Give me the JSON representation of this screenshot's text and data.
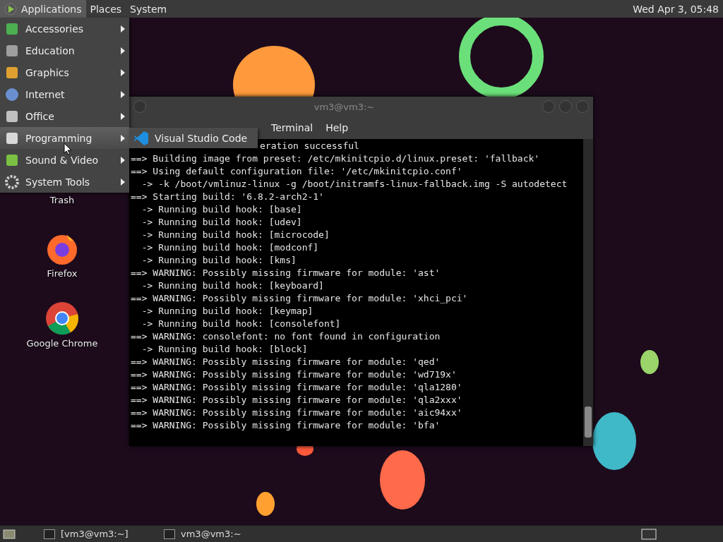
{
  "top_panel": {
    "menus": [
      {
        "label": "Applications",
        "selected": true
      },
      {
        "label": "Places",
        "selected": false
      },
      {
        "label": "System",
        "selected": false
      }
    ],
    "clock": "Wed Apr 3, 05:48"
  },
  "applications_menu": {
    "items": [
      {
        "label": "Accessories",
        "selected": false
      },
      {
        "label": "Education",
        "selected": false
      },
      {
        "label": "Graphics",
        "selected": false
      },
      {
        "label": "Internet",
        "selected": false
      },
      {
        "label": "Office",
        "selected": false
      },
      {
        "label": "Programming",
        "selected": true
      },
      {
        "label": "Sound & Video",
        "selected": false
      },
      {
        "label": "System Tools",
        "selected": false
      }
    ],
    "submenu": [
      {
        "label": "Visual Studio Code"
      }
    ]
  },
  "desktop_icons": [
    {
      "label": "Trash",
      "kind": "trash"
    },
    {
      "label": "Firefox",
      "kind": "firefox"
    },
    {
      "label": "Google Chrome",
      "kind": "chrome"
    }
  ],
  "terminal": {
    "title": "vm3@vm3:~",
    "menu": [
      "Terminal",
      "Help"
    ],
    "lines": [
      "eration successful",
      "==> Building image from preset: /etc/mkinitcpio.d/linux.preset: 'fallback'",
      "==> Using default configuration file: '/etc/mkinitcpio.conf'",
      "  -> -k /boot/vmlinuz-linux -g /boot/initramfs-linux-fallback.img -S autodetect",
      "==> Starting build: '6.8.2-arch2-1'",
      "  -> Running build hook: [base]",
      "  -> Running build hook: [udev]",
      "  -> Running build hook: [microcode]",
      "  -> Running build hook: [modconf]",
      "  -> Running build hook: [kms]",
      "==> WARNING: Possibly missing firmware for module: 'ast'",
      "  -> Running build hook: [keyboard]",
      "==> WARNING: Possibly missing firmware for module: 'xhci_pci'",
      "  -> Running build hook: [keymap]",
      "  -> Running build hook: [consolefont]",
      "==> WARNING: consolefont: no font found in configuration",
      "  -> Running build hook: [block]",
      "==> WARNING: Possibly missing firmware for module: 'qed'",
      "==> WARNING: Possibly missing firmware for module: 'wd719x'",
      "==> WARNING: Possibly missing firmware for module: 'qla1280'",
      "==> WARNING: Possibly missing firmware for module: 'qla2xxx'",
      "==> WARNING: Possibly missing firmware for module: 'aic94xx'",
      "==> WARNING: Possibly missing firmware for module: 'bfa'"
    ]
  },
  "taskbar": {
    "items": [
      {
        "label": "[vm3@vm3:~]"
      },
      {
        "label": "vm3@vm3:~"
      }
    ]
  }
}
